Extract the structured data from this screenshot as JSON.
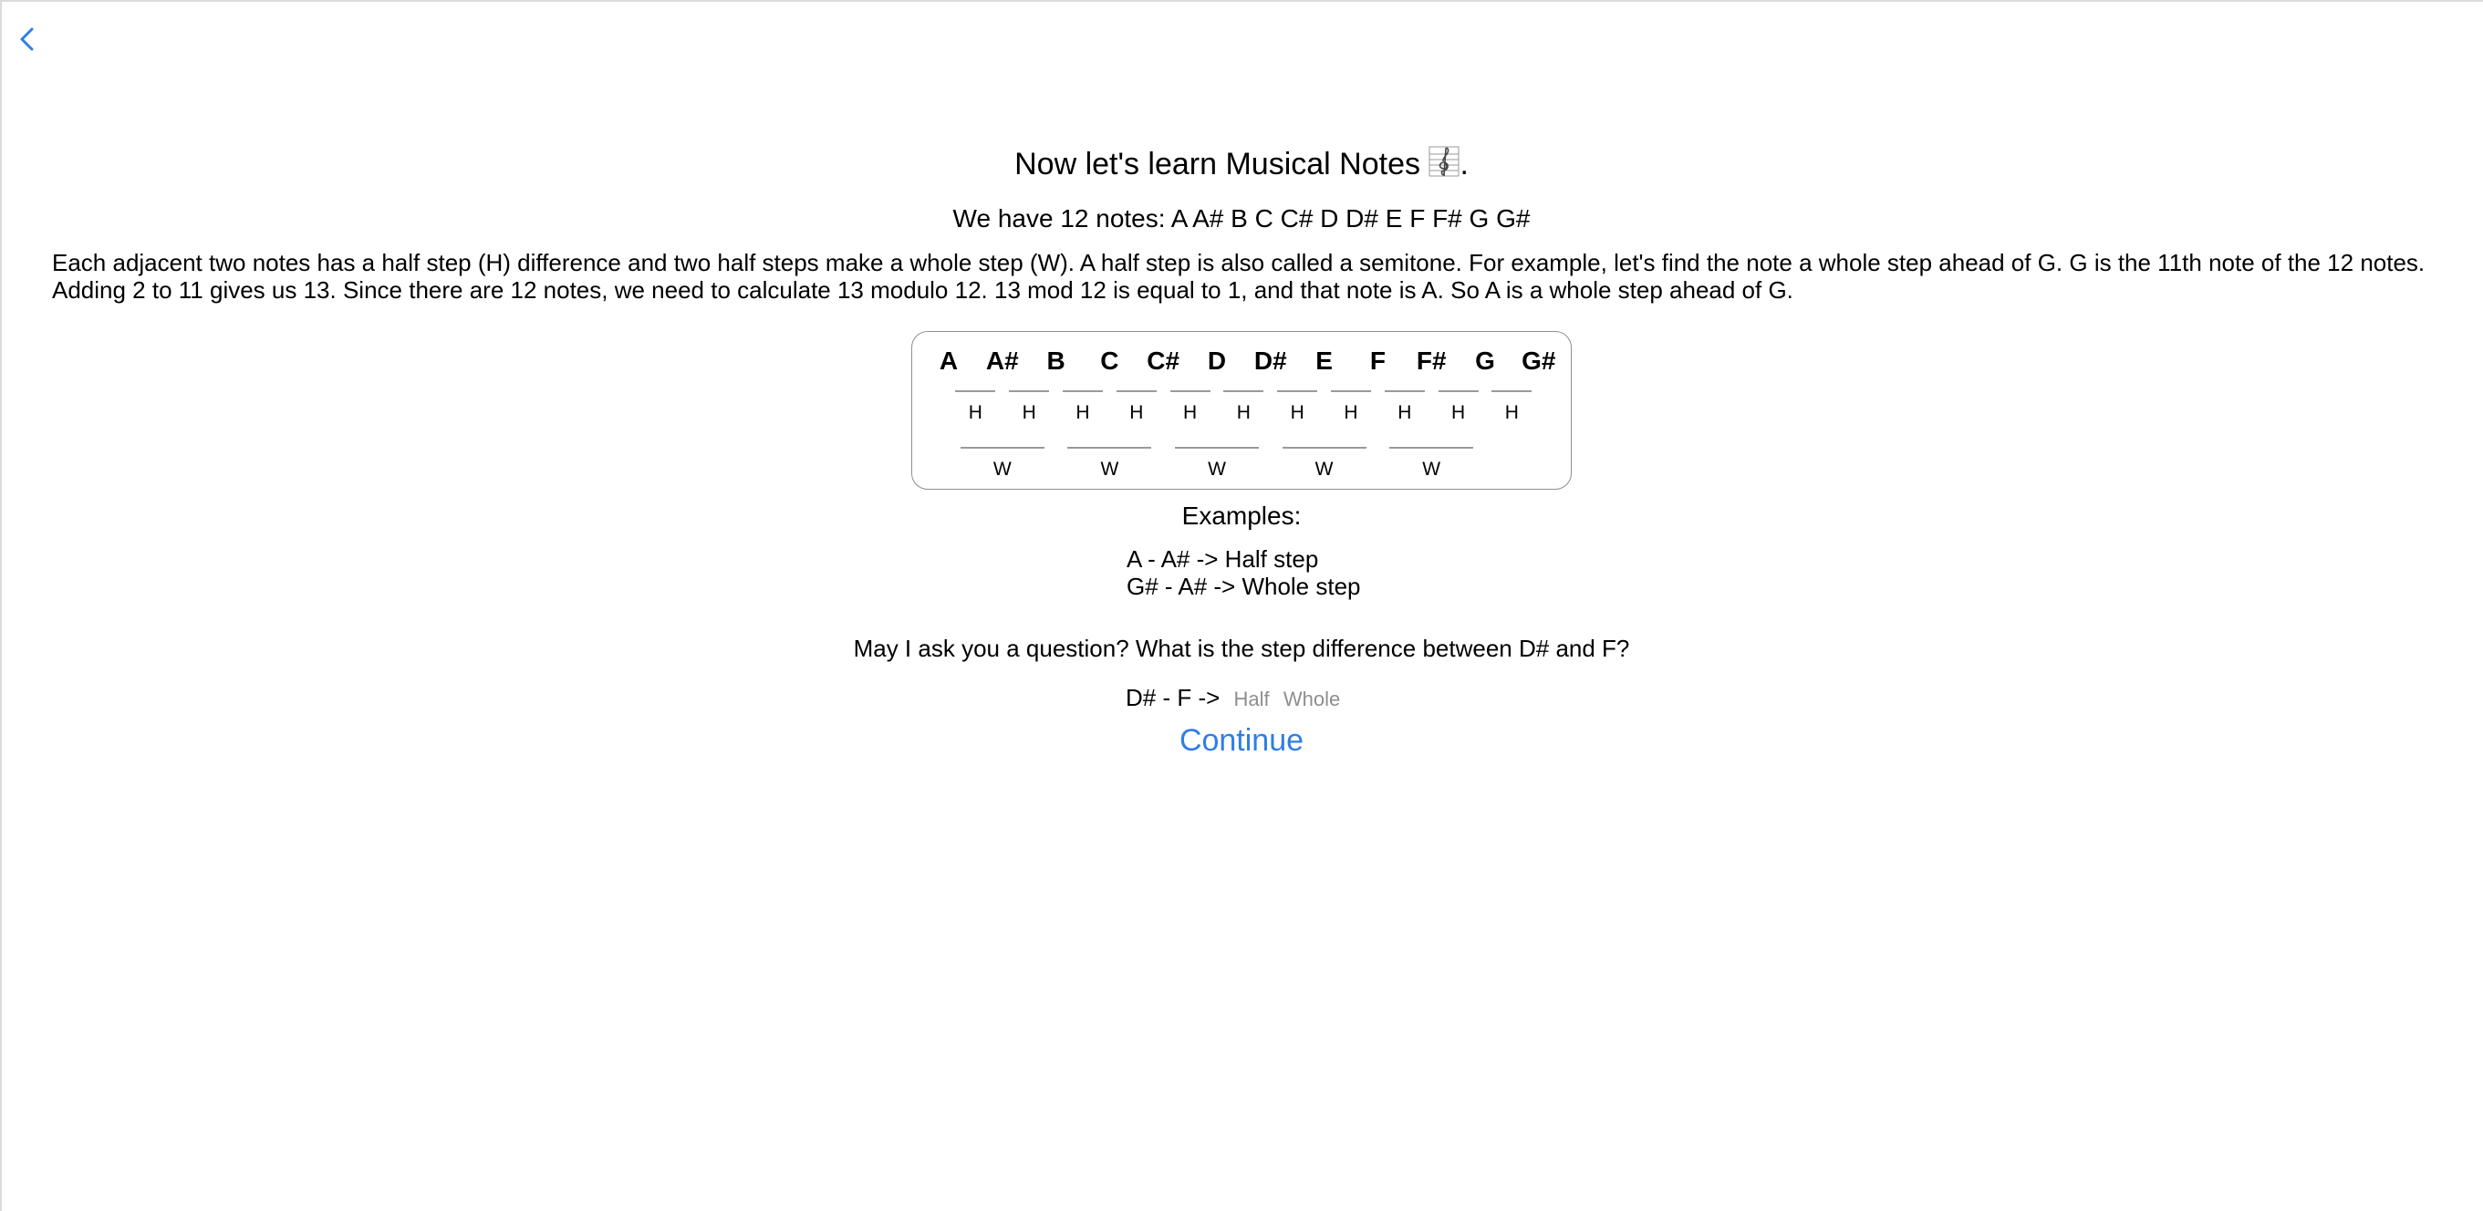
{
  "nav": {
    "back_icon": "chevron-left-icon",
    "accent_color": "#2f7ee6"
  },
  "header": {
    "title": "Now let's learn Musical Notes",
    "title_icon": "treble-clef-icon",
    "title_suffix": "."
  },
  "subtitle": "We have 12 notes: A A# B C C# D D# E F F# G G#",
  "paragraph": "Each adjacent two notes has a half step (H) difference and two half steps make a whole step (W). A half step is also called a semitone. For example, let's find the note a whole step ahead of G. G is the 11th note of the 12 notes. Adding 2 to 11 gives us 13. Since there are 12 notes, we need to calculate 13 modulo 12. 13 mod 12 is equal to 1, and that note is A. So A is a whole step ahead of G.",
  "notes_table": {
    "notes": [
      "A",
      "A#",
      "B",
      "C",
      "C#",
      "D",
      "D#",
      "E",
      "F",
      "F#",
      "G",
      "G#"
    ],
    "half_steps": [
      "H",
      "H",
      "H",
      "H",
      "H",
      "H",
      "H",
      "H",
      "H",
      "H",
      "H"
    ],
    "whole_steps": [
      "W",
      "W",
      "W",
      "W",
      "W"
    ]
  },
  "examples": {
    "title": "Examples:",
    "items": [
      "A - A# -> Half step",
      "G# - A# -> Whole step"
    ]
  },
  "question": {
    "text": "May I ask you a question? What is the step difference between D# and F?",
    "prompt": "D# - F ->",
    "options": [
      "Half",
      "Whole"
    ]
  },
  "continue_label": "Continue"
}
